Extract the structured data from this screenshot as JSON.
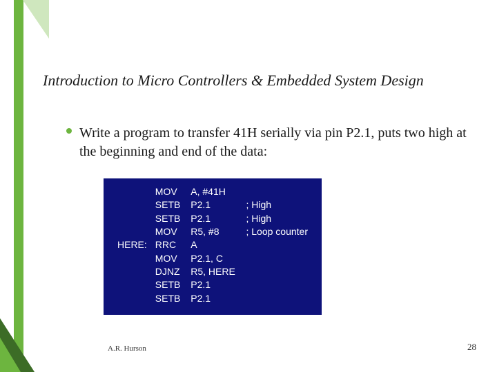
{
  "title": "Introduction to Micro Controllers & Embedded System Design",
  "body": "Write a program to transfer 41H serially via pin P2.1, puts two high at the beginning and end of the data:",
  "code": [
    {
      "label": "",
      "op": "MOV",
      "arg": "A, #41H",
      "comment": ""
    },
    {
      "label": "",
      "op": "SETB",
      "arg": "P2.1",
      "comment": "; High"
    },
    {
      "label": "",
      "op": "SETB",
      "arg": "P2.1",
      "comment": "; High"
    },
    {
      "label": "",
      "op": "MOV",
      "arg": "R5, #8",
      "comment": "; Loop counter"
    },
    {
      "label": "HERE:",
      "op": "RRC",
      "arg": "A",
      "comment": ""
    },
    {
      "label": "",
      "op": "MOV",
      "arg": "P2.1, C",
      "comment": ""
    },
    {
      "label": "",
      "op": "DJNZ",
      "arg": "R5, HERE",
      "comment": ""
    },
    {
      "label": "",
      "op": "SETB",
      "arg": "P2.1",
      "comment": ""
    },
    {
      "label": "",
      "op": "SETB",
      "arg": "P2.1",
      "comment": ""
    }
  ],
  "footer": {
    "author": "A.R. Hurson",
    "page": "28"
  }
}
